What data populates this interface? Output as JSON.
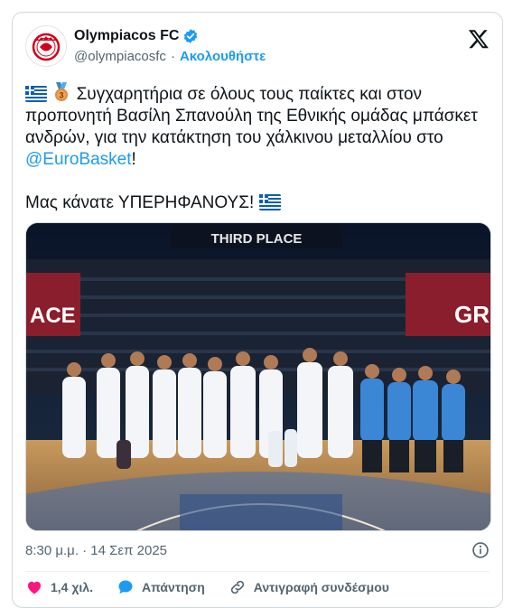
{
  "account": {
    "name": "Olympiacos FC",
    "handle": "@olympiacosfc",
    "separator": "·",
    "follow_label": "Ακολουθήστε"
  },
  "tweet": {
    "line1_pre": "Συγχαρητήρια σε όλους τους παίκτες και στον προπονητή Βασίλη Σπανούλη της Εθνικής ομάδας μπάσκετ ανδρών, για την κατάκτηση του χάλκινου μεταλλίου στο ",
    "mention": "@EuroBasket",
    "line1_post": "!",
    "line2": "Μας κάνατε ΥΠΕΡΗΦΑΝΟΥΣ! ",
    "medal_number": "3"
  },
  "photo": {
    "banner_text": "THIRD PLACE",
    "left_board_text": "ACE",
    "right_board_text": "GR"
  },
  "timestamp": "8:30 μ.μ. · 14 Σεπ 2025",
  "actions": {
    "likes": "1,4 χιλ.",
    "reply": "Απάντηση",
    "copy_link": "Αντιγραφή συνδέσμου"
  },
  "colors": {
    "accent": "#1d9bf0",
    "like": "#f91880",
    "brand_red": "#d0021b"
  }
}
